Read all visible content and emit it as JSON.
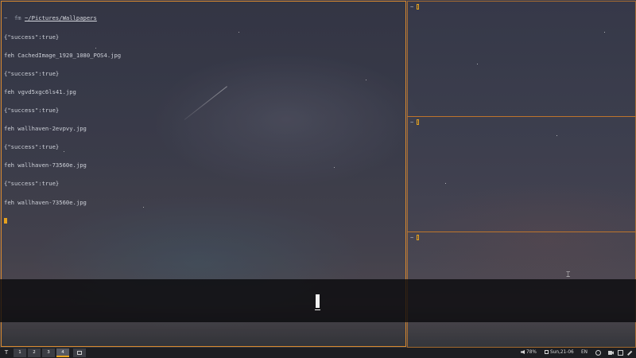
{
  "terminal_main": {
    "prompt": {
      "tilde": "~",
      "command": "fm",
      "path": "~/Pictures/Wallpapers"
    },
    "lines": [
      "{\"success\":true}",
      "feh CachedImage_1920_1080_POS4.jpg",
      "{\"success\":true}",
      "feh vgvd5xgc6ls41.jpg",
      "{\"success\":true}",
      "feh wallhaven-2evpvy.jpg",
      "{\"success\":true}",
      "feh wallhaven-73560e.jpg",
      "{\"success\":true}",
      "feh wallhaven-73560e.jpg"
    ]
  },
  "terminal_r1": {
    "prompt": "~"
  },
  "terminal_r2": {
    "prompt": "~"
  },
  "terminal_r3": {
    "prompt": "~"
  },
  "taskbar": {
    "left_icon": "T",
    "workspaces": [
      "1",
      "2",
      "3",
      "4"
    ],
    "active_workspace": "4",
    "volume_label": "78%",
    "clock_label": "Sun,21-06",
    "keyboard_layout": "EN",
    "icons": [
      "speaker-icon",
      "calendar-icon",
      "globe-icon",
      "camera-icon",
      "window-icon",
      "pencil-icon"
    ]
  },
  "accent_color": "#e6a21e",
  "border_color": "#c97b2b"
}
